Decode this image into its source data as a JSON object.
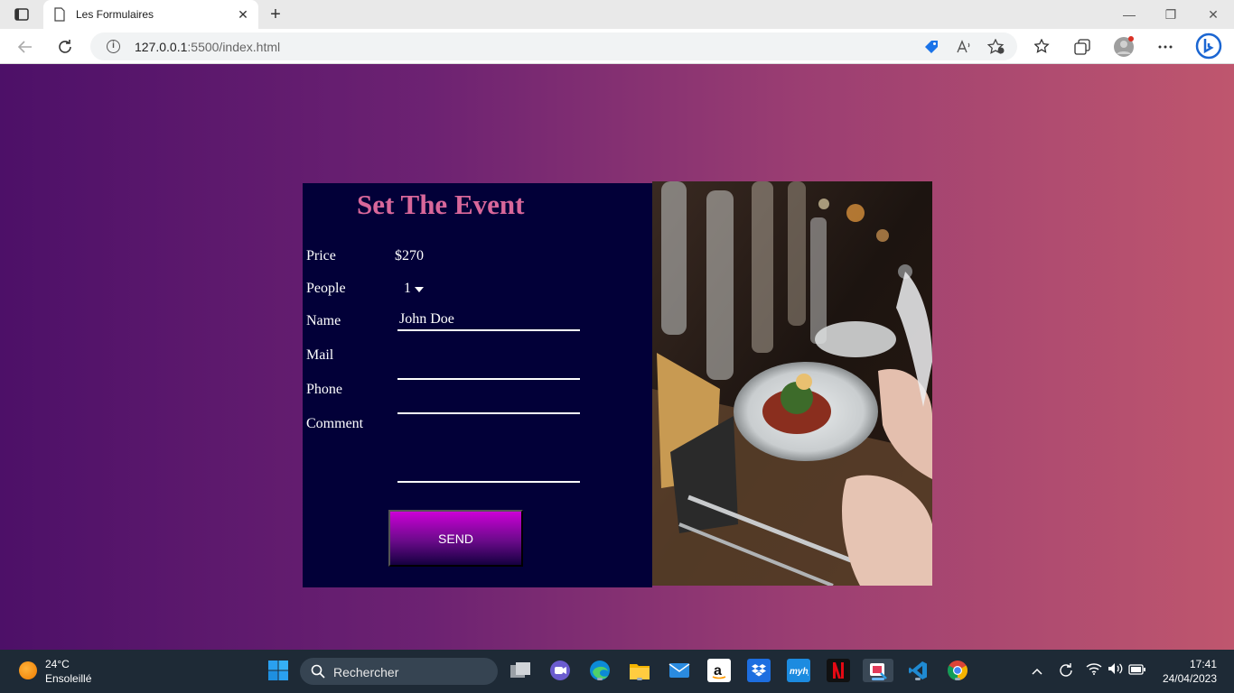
{
  "browser": {
    "tab_title": "Les Formulaires",
    "close_glyph": "✕",
    "new_tab_glyph": "+",
    "url_host": "127.0.0.1",
    "url_path": ":5500/index.html",
    "window_controls": {
      "minimize": "—",
      "restore": "❐",
      "close": "✕"
    }
  },
  "form": {
    "title": "Set The Event",
    "price_label": "Price",
    "price_value": "$270",
    "people_label": "People",
    "people_selected": "1",
    "name_label": "Name",
    "name_value": "John Doe",
    "mail_label": "Mail",
    "mail_value": "",
    "phone_label": "Phone",
    "phone_value": "",
    "comment_label": "Comment",
    "comment_value": "",
    "send_label": "SEND"
  },
  "taskbar": {
    "weather_temp": "24°C",
    "weather_desc": "Ensoleillé",
    "search_placeholder": "Rechercher",
    "time": "17:41",
    "date": "24/04/2023"
  },
  "colors": {
    "page_gradient_start": "#4d1068",
    "page_gradient_end": "#bf566e",
    "form_bg": "#020038",
    "title_color": "#d8679a",
    "send_gradient_top": "#cc00d6",
    "taskbar_bg": "#1e2a36"
  }
}
